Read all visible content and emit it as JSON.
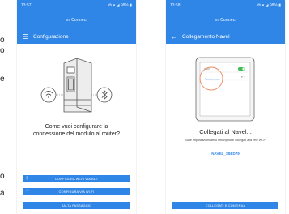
{
  "fragments": {
    "left_top": [
      "o",
      "o"
    ],
    "left_mid": "e",
    "left_bottom": [
      "o",
      "a"
    ]
  },
  "phone1": {
    "status_time": "13:57",
    "status_right": "⚙ ▾ ◢ 98% ▮",
    "brand_prefix": "MIO",
    "brand": "Connect",
    "title": "Configurazione",
    "question_line1": "Come vuoi configurare la",
    "question_line2": "connessione del modulo al router?",
    "buttons": {
      "ble": "CONFIGURA WI-FI VIA BLE",
      "wifi": "CONFIGURA VIA WI-FI",
      "skip": "SALTA PASSAGGIO"
    }
  },
  "phone2": {
    "status_time": "13:58",
    "status_right": "⚙ ▾ ◢ 98% ▮",
    "brand_prefix": "MIO",
    "brand": "Connect",
    "title": "Collegamento Navel",
    "tablet_wifi_label": "Wi-Fi",
    "tablet_network_label": "Navel_xxxxxx",
    "title_main": "Collegati al Navel...",
    "description": "Sulle impostazioni dello smartphone collegati alla rete Wi-Fi",
    "ssid": "NAVEL_7BED79",
    "connect_button": "COLLEGATI E CONTINUA"
  },
  "colors": {
    "primary": "#2f86e6",
    "highlight": "#e88a5a",
    "toggle": "#3cbf4f"
  },
  "icons": {
    "hamburger": "menu-icon",
    "back": "back-arrow-icon",
    "bluetooth": "bluetooth-icon",
    "wifi": "wifi-icon"
  }
}
